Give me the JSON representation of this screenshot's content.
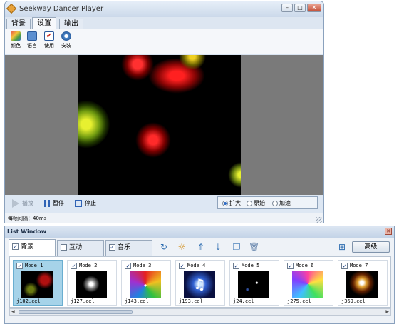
{
  "main_window": {
    "title": "Seekway Dancer Player",
    "buttons": {
      "minimize": "–",
      "maximize": "□",
      "close": "✕"
    },
    "tabs": [
      "背景",
      "设置",
      "输出"
    ],
    "active_tab": "设置",
    "toolbar": [
      {
        "label": "颜色",
        "icon": "palette-icon"
      },
      {
        "label": "语言",
        "icon": "language-icon"
      },
      {
        "label": "使用",
        "icon": "checklist-icon"
      },
      {
        "label": "安装",
        "icon": "gear-icon"
      }
    ],
    "controls": {
      "play": "播放",
      "pause": "暂停",
      "stop": "停止"
    },
    "view_modes": {
      "options": [
        "扩大",
        "原始",
        "加速"
      ],
      "selected": "扩大"
    },
    "status": "每帧间隔：40ms"
  },
  "list_window": {
    "title": "List Window",
    "close": "✕",
    "tabs": [
      {
        "label": "背景",
        "checked": true,
        "active": true
      },
      {
        "label": "互动",
        "checked": false,
        "active": false
      },
      {
        "label": "音乐",
        "checked": true,
        "active": false
      }
    ],
    "toolbar_icons": [
      "refresh-icon",
      "brightness-icon",
      "move-up-icon",
      "move-down-icon",
      "copy-icon",
      "delete-icon",
      "tree-icon"
    ],
    "advanced_label": "高级",
    "items": [
      {
        "mode": "Mode 1",
        "file": "j102.cel",
        "checked": true,
        "selected": true
      },
      {
        "mode": "Mode 2",
        "file": "j127.cel",
        "checked": true,
        "selected": false
      },
      {
        "mode": "Mode 3",
        "file": "j143.cel",
        "checked": true,
        "selected": false
      },
      {
        "mode": "Mode 4",
        "file": "j193.cel",
        "checked": true,
        "selected": false
      },
      {
        "mode": "Mode 5",
        "file": "j24.cel",
        "checked": true,
        "selected": false
      },
      {
        "mode": "Mode 6",
        "file": "j275.cel",
        "checked": true,
        "selected": false
      },
      {
        "mode": "Mode 7",
        "file": "j369.cel",
        "checked": true,
        "selected": false
      }
    ]
  }
}
